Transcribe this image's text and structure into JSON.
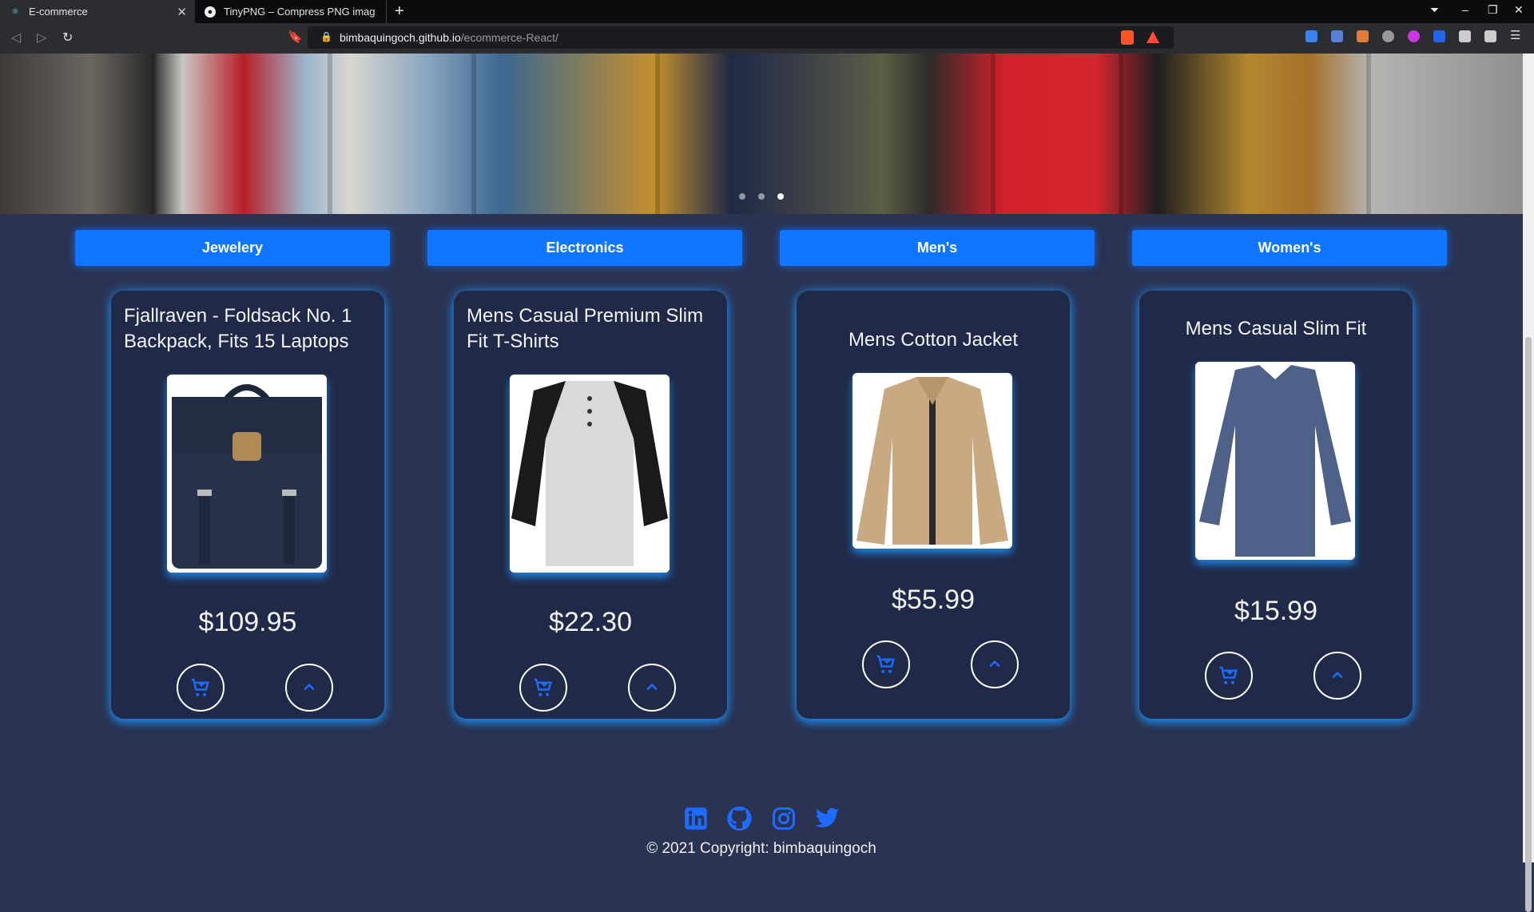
{
  "browser": {
    "tabs": [
      {
        "title": "E-commerce",
        "active": true
      },
      {
        "title": "TinyPNG – Compress PNG imag",
        "active": false
      }
    ],
    "address_host": "bimbaquingoch.github.io",
    "address_path": "/ecommerce-React/"
  },
  "carousel": {
    "slides": 3,
    "active_slide": 3
  },
  "categories": [
    "Jewelery",
    "Electronics",
    "Men's",
    "Women's"
  ],
  "products": [
    {
      "title": "Fjallraven - Foldsack No. 1 Backpack, Fits 15 Laptops",
      "price": "$109.95",
      "image": "navy-backpack"
    },
    {
      "title": "Mens Casual Premium Slim Fit T-Shirts",
      "price": "$22.30",
      "image": "raglan-henley-shirt"
    },
    {
      "title": "Mens Cotton Jacket",
      "price": "$55.99",
      "image": "khaki-jacket"
    },
    {
      "title": "Mens Casual Slim Fit",
      "price": "$15.99",
      "image": "blue-long-sleeve-tee"
    }
  ],
  "footer": {
    "icons": [
      "linkedin-icon",
      "github-icon",
      "instagram-icon",
      "twitter-icon"
    ],
    "copyright": "© 2021 Copyright:  bimbaquingoch"
  },
  "colors": {
    "accent": "#1176ff",
    "background": "#2a3352",
    "card": "#202a48",
    "glow": "#1e96ff"
  }
}
